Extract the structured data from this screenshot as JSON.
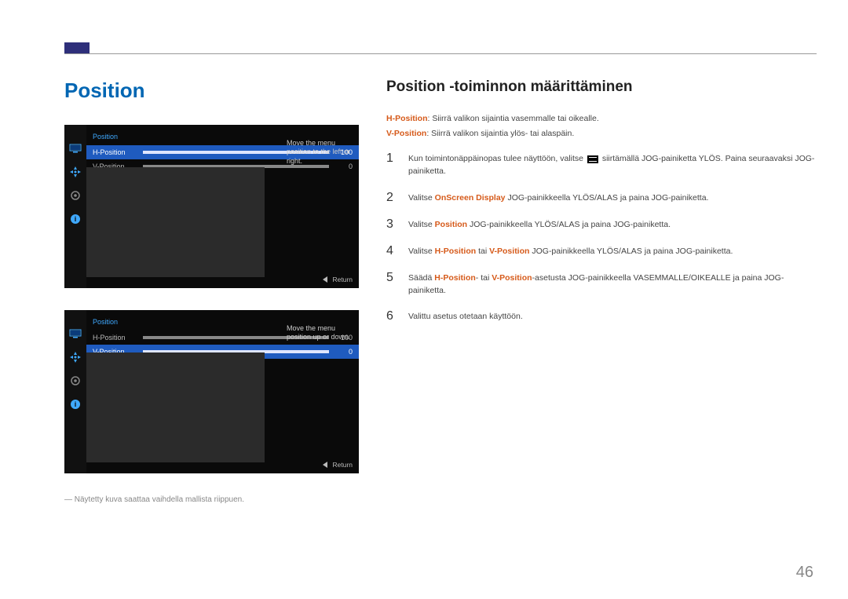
{
  "page_number": "46",
  "main_title": "Position",
  "sub_title": "Position -toiminnon määrittäminen",
  "desc": {
    "h_label": "H-Position",
    "h_text": ": Siirrä valikon sijaintia vasemmalle tai oikealle.",
    "v_label": "V-Position",
    "v_text": ": Siirrä valikon sijaintia ylös- tai alaspäin."
  },
  "steps": [
    {
      "num": "1",
      "pre": "Kun toimintonäppäinopas tulee näyttöön, valitse ",
      "post": " siirtämällä JOG-painiketta YLÖS. Paina seuraavaksi JOG-painiketta.",
      "has_glyph": true
    },
    {
      "num": "2",
      "pre": "Valitse ",
      "em": "OnScreen Display",
      "post": " JOG-painikkeella YLÖS/ALAS ja paina JOG-painiketta."
    },
    {
      "num": "3",
      "pre": "Valitse ",
      "em": "Position",
      "post": " JOG-painikkeella YLÖS/ALAS ja paina JOG-painiketta."
    },
    {
      "num": "4",
      "pre": "Valitse ",
      "em": "H-Position",
      "mid": " tai ",
      "em2": "V-Position",
      "post": " JOG-painikkeella YLÖS/ALAS ja paina JOG-painiketta."
    },
    {
      "num": "5",
      "pre": "Säädä ",
      "em": "H-Position",
      "mid": "- tai ",
      "em2": "V-Position",
      "post": "-asetusta JOG-painikkeella VASEMMALLE/OIKEALLE ja paina JOG-painiketta."
    },
    {
      "num": "6",
      "pre": "Valittu asetus otetaan käyttöön."
    }
  ],
  "osd1": {
    "title": "Position",
    "rows": [
      {
        "label": "H-Position",
        "value": "100",
        "selected": true
      },
      {
        "label": "V-Position",
        "value": "0",
        "selected": false
      }
    ],
    "info": "Move the menu position to the left or right.",
    "return": "Return"
  },
  "osd2": {
    "title": "Position",
    "rows": [
      {
        "label": "H-Position",
        "value": "100",
        "selected": false
      },
      {
        "label": "V-Position",
        "value": "0",
        "selected": true
      }
    ],
    "info": "Move the menu position up or down.",
    "return": "Return"
  },
  "footnote": "― Näytetty kuva saattaa vaihdella mallista riippuen."
}
